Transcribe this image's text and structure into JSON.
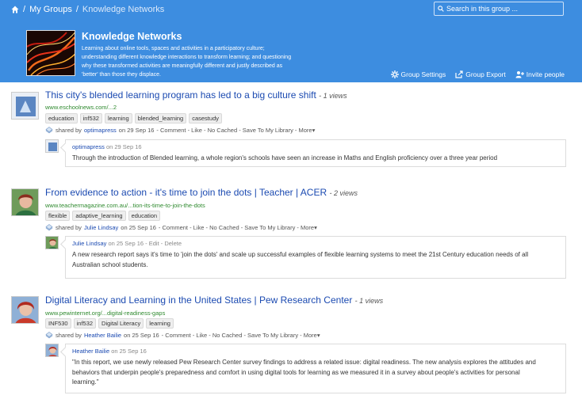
{
  "breadcrumb": {
    "my_groups": "My Groups",
    "current": "Knowledge Networks",
    "separator": "/"
  },
  "search": {
    "placeholder": "Search in this group ..."
  },
  "group": {
    "title": "Knowledge Networks",
    "description_lines": [
      "Learning about online tools, spaces and activities in a participatory culture;",
      "understanding different knowledge interactions to transform learning; and questioning",
      "why these transformed activities are meaningfully different and justly described as",
      "'better' than those they displace."
    ],
    "actions": {
      "settings": "Group Settings",
      "export": "Group Export",
      "invite": "Invite people"
    }
  },
  "posts": [
    {
      "title": "This city's blended learning program has led to a big culture shift",
      "views": "- 1 views",
      "url": "www.eschoolnews.com/...2",
      "tags": [
        "education",
        "inf532",
        "learning",
        "blended_learning",
        "casestudy"
      ],
      "shared_prefix": "shared by",
      "shared_user": "optimapress",
      "shared_date": "on 29 Sep 16",
      "shared_actions": "- Comment - Like - No Cached - Save To My Library - More▾",
      "comment": {
        "user": "optimapress",
        "date": "on 29 Sep 16",
        "extra": "",
        "lines": [
          "Through the introduction of Blended learning, a whole region's schools have seen an increase in Maths and English proficiency over a three year period"
        ]
      }
    },
    {
      "title": "From evidence to action - it's time to join the dots | Teacher | ACER",
      "views": "- 2 views",
      "url": "www.teachermagazine.com.au/...tion-its-time-to-join-the-dots",
      "tags": [
        "flexible",
        "adaptive_learning",
        "education"
      ],
      "shared_prefix": "shared by",
      "shared_user": "Julie Lindsay",
      "shared_date": "on 25 Sep 16",
      "shared_actions": "- Comment - Like - No Cached - Save To My Library - More▾",
      "comment": {
        "user": "Julie Lindsay",
        "date": "on 25 Sep 16",
        "extra": "- Edit - Delete",
        "lines": [
          "A new research report says it's time to 'join the dots' and scale up successful examples of flexible learning systems to meet the 21st Century education needs of all",
          "Australian school students."
        ]
      }
    },
    {
      "title": "Digital Literacy and Learning in the United States | Pew Research Center",
      "views": "- 1 views",
      "url": "www.pewinternet.org/...digital-readiness-gaps",
      "tags": [
        "INF530",
        "inf532",
        "Digital Literacy",
        "learning"
      ],
      "shared_prefix": "shared by",
      "shared_user": "Heather Bailie",
      "shared_date": "on 25 Sep 16",
      "shared_actions": "- Comment - Like - No Cached - Save To My Library - More▾",
      "comment": {
        "user": "Heather Bailie",
        "date": "on 25 Sep 16",
        "extra": "",
        "lines": [
          "\"In this report, we use newly released Pew Research Center survey findings to address a related issue: digital readiness. The new analysis explores the attitudes and",
          "behaviors that underpin people's preparedness and comfort in using digital tools for learning as we measured it in a survey about people's activities for personal",
          "learning.\""
        ]
      }
    }
  ],
  "colors": {
    "header_bg": "#3d8de0",
    "link": "#1b4ab1",
    "url": "#2f8a2f"
  },
  "icons": [
    "home-icon",
    "search-icon",
    "gear-icon",
    "export-icon",
    "invite-icon",
    "share-icon"
  ]
}
